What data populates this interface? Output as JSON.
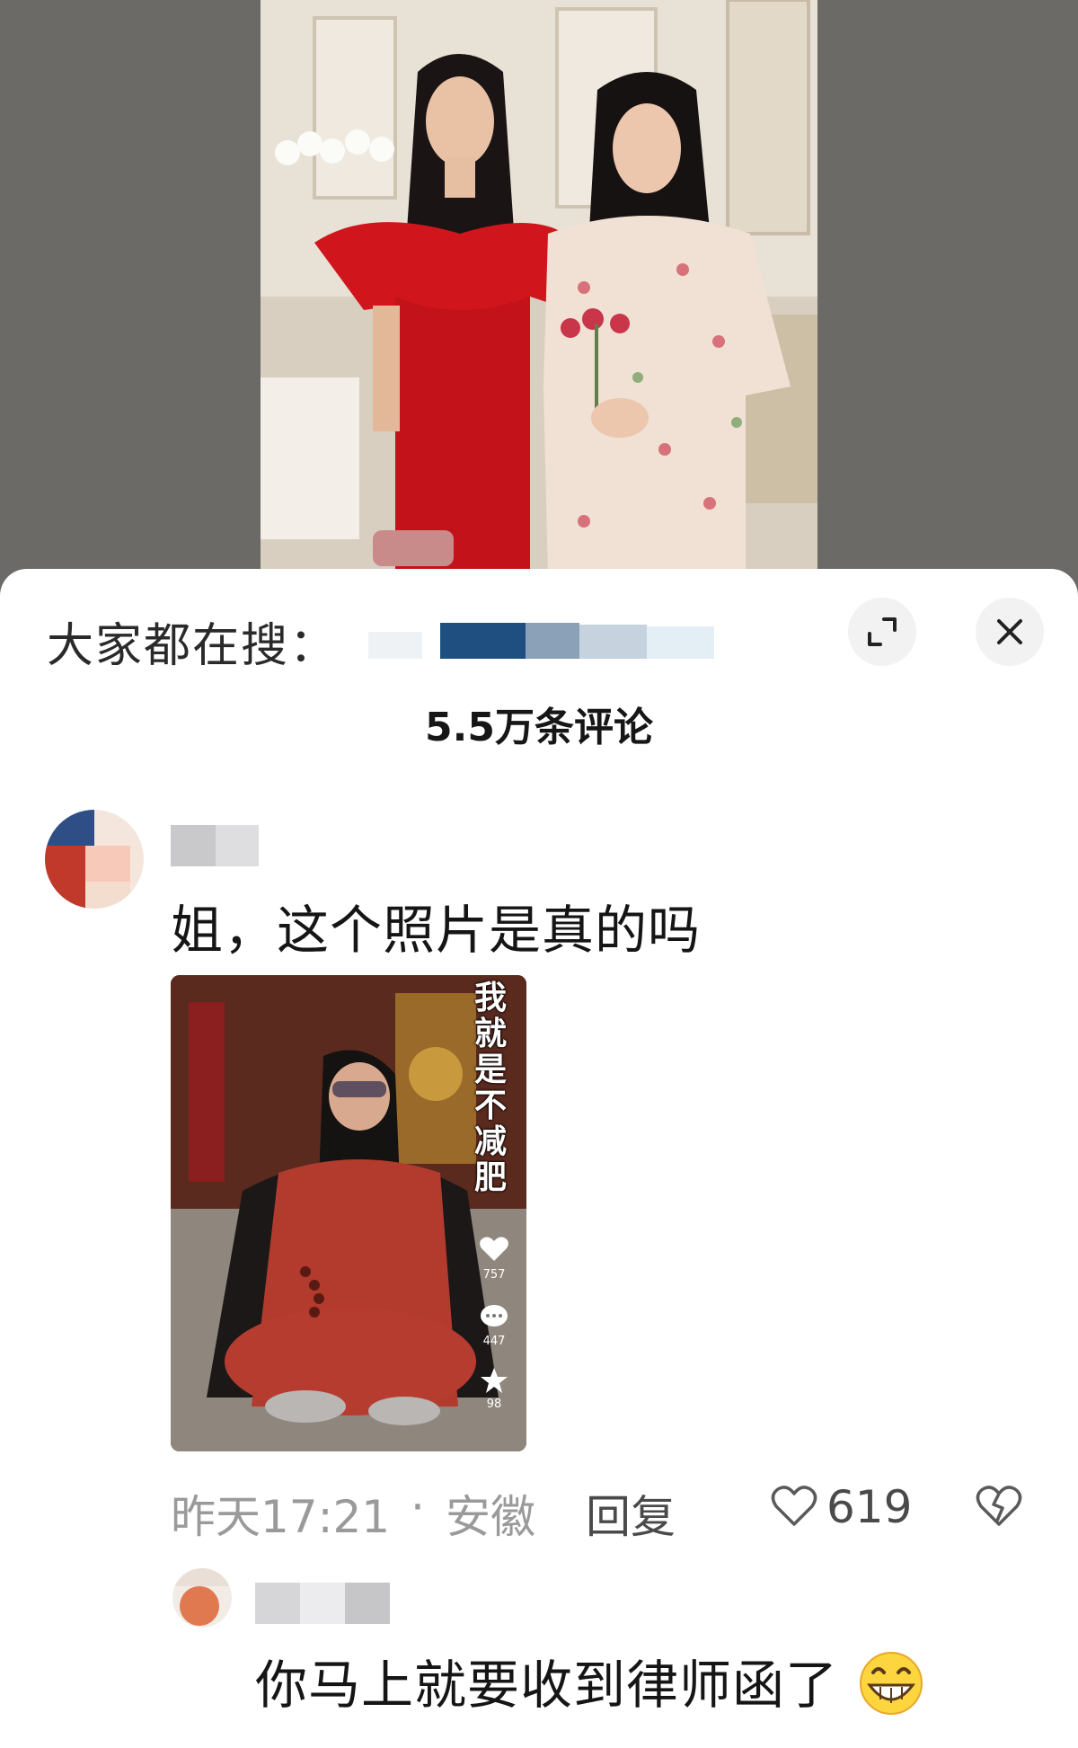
{
  "search_bar": {
    "label": "大家都在搜："
  },
  "comments_header": {
    "count_label": "5.5万条评论"
  },
  "comments": [
    {
      "text": "姐，这个照片是真的吗",
      "attached_image": {
        "caption": "我就是不减肥",
        "likes": "757",
        "comments": "447",
        "favorites": "98"
      },
      "time": "昨天17:21",
      "separator": "·",
      "location": "安徽",
      "reply_label": "回复",
      "like_count": "619"
    },
    {
      "text": "你马上就要收到律师函了",
      "emoji": "grinning-face-icon"
    }
  ],
  "icons": {
    "expand": "expand-icon",
    "close": "close-icon",
    "like": "heart-outline-icon",
    "dislike": "broken-heart-icon"
  },
  "colors": {
    "sheet_bg": "#ffffff",
    "backdrop": "#6b6a66",
    "meta_text": "#9a9a9a",
    "primary_text": "#151515"
  }
}
